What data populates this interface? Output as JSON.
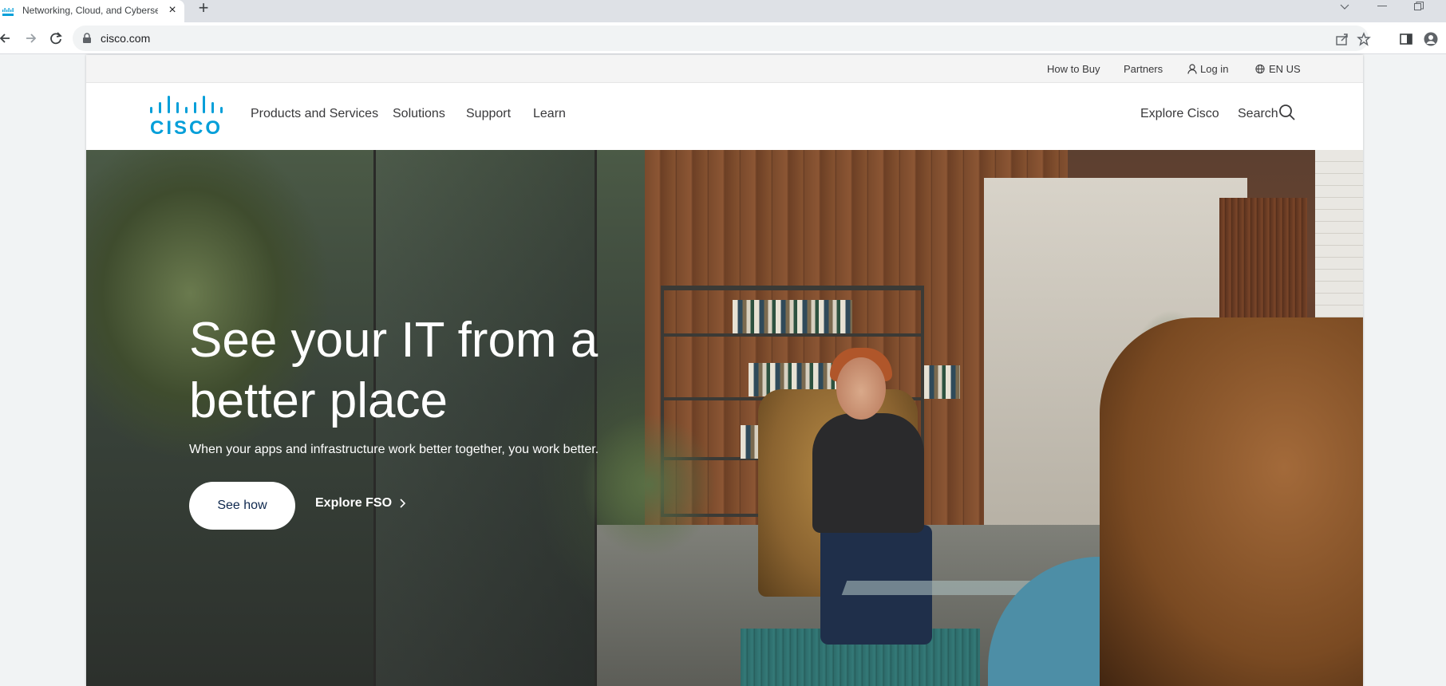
{
  "browser": {
    "tab": {
      "title": "Networking, Cloud, and Cyberse",
      "favicon": "cisco-favicon-icon",
      "close_glyph": "×"
    },
    "new_tab_glyph": "+",
    "window_controls": [
      "chevron-down-icon",
      "minimize-icon",
      "restore-icon"
    ],
    "address": {
      "url": "cisco.com"
    },
    "icons": [
      "back-arrow-icon",
      "forward-arrow-icon",
      "reload-icon",
      "lock-icon",
      "share-icon",
      "star-icon",
      "side-panel-icon",
      "profile-icon"
    ]
  },
  "utility_nav": {
    "how_to_buy": "How to Buy",
    "partners": "Partners",
    "log_in": "Log in",
    "language": "EN US"
  },
  "main_nav": {
    "logo_text": "CISCO",
    "items": [
      "Products and Services",
      "Solutions",
      "Support",
      "Learn"
    ],
    "explore": "Explore Cisco",
    "search": "Search"
  },
  "hero": {
    "title": "See your IT from a better place",
    "subtitle": "When your apps and infrastructure work better together, you work better.",
    "primary_cta": "See how",
    "secondary_cta": "Explore FSO"
  },
  "colors": {
    "brand_cyan": "#049fd9",
    "nav_text": "#39393b",
    "cta_text": "#0d274d"
  }
}
